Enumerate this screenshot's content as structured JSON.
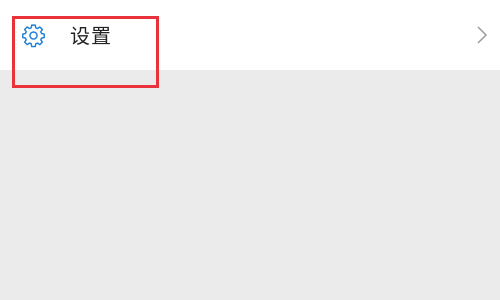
{
  "settings_row": {
    "icon": "gear-icon",
    "label": "设置",
    "chevron": "chevron-right-icon"
  },
  "colors": {
    "accent_icon": "#1e7fd6",
    "highlight": "#e8333a",
    "background": "#ebebeb",
    "row_background": "#ffffff"
  }
}
